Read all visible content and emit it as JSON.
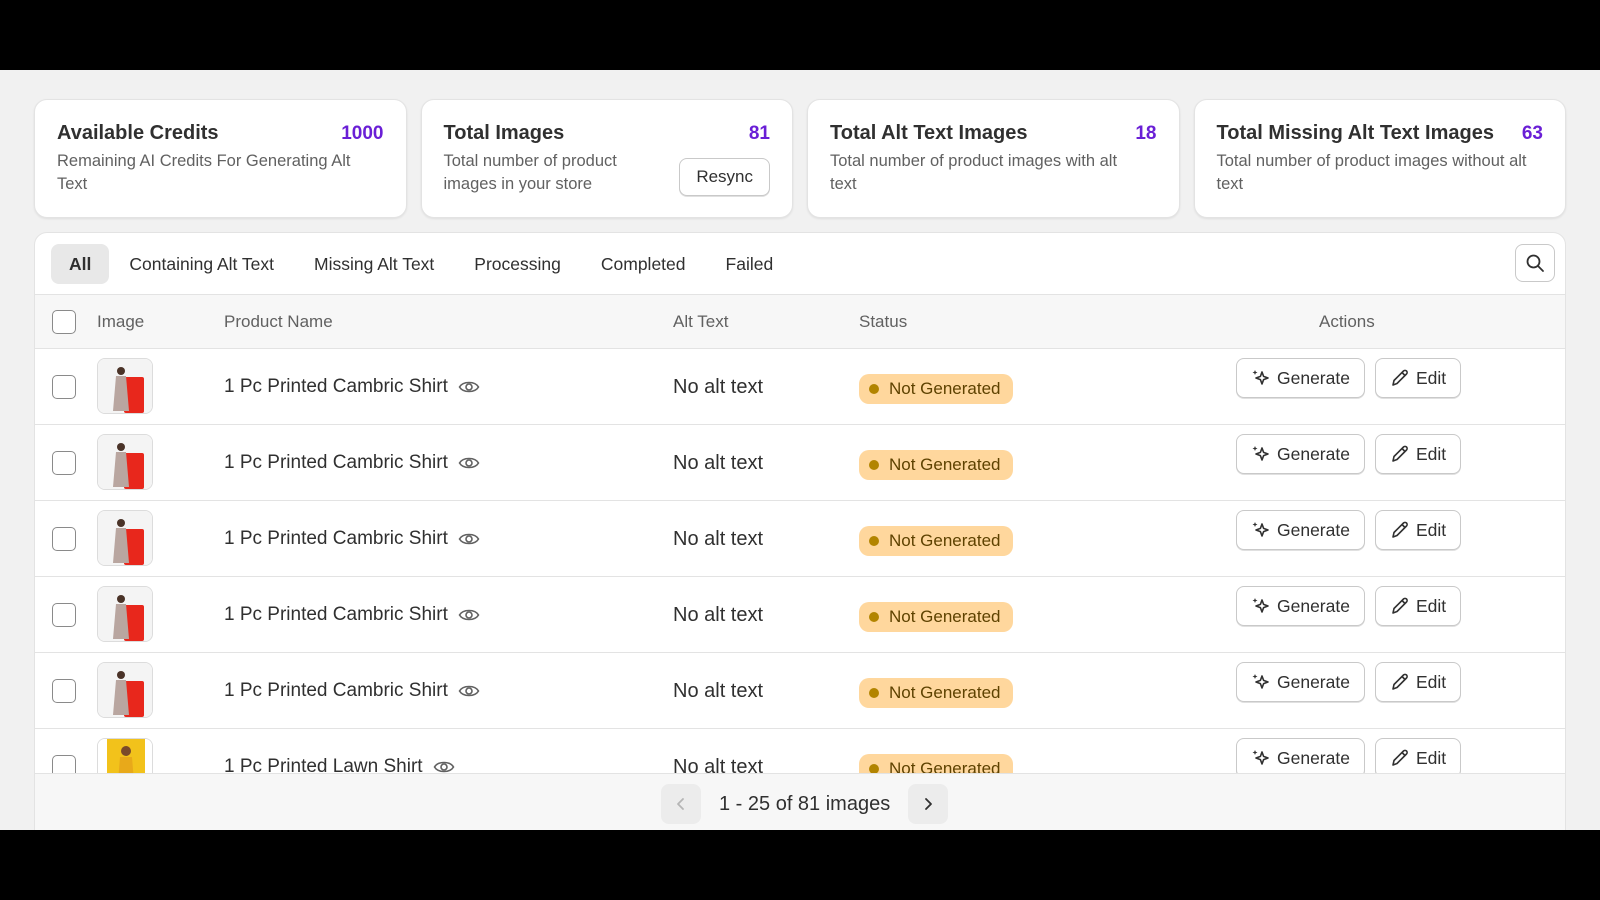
{
  "stats": [
    {
      "title": "Available Credits",
      "value": "1000",
      "desc": "Remaining AI Credits For Generating Alt Text"
    },
    {
      "title": "Total Images",
      "value": "81",
      "desc": "Total number of product images in your store",
      "button": "Resync"
    },
    {
      "title": "Total Alt Text Images",
      "value": "18",
      "desc": "Total number of product images with alt text"
    },
    {
      "title": "Total Missing Alt Text Images",
      "value": "63",
      "desc": "Total number of product images without alt text"
    }
  ],
  "tabs": [
    "All",
    "Containing Alt Text",
    "Missing Alt Text",
    "Processing",
    "Completed",
    "Failed"
  ],
  "columns": {
    "image": "Image",
    "product_name": "Product Name",
    "alt_text": "Alt Text",
    "status": "Status",
    "actions": "Actions"
  },
  "rows": [
    {
      "name": "1 Pc Printed Cambric Shirt",
      "alt": "No alt text",
      "status": "Not Generated",
      "generate": "Generate",
      "edit": "Edit",
      "thumb": "red"
    },
    {
      "name": "1 Pc Printed Cambric Shirt",
      "alt": "No alt text",
      "status": "Not Generated",
      "generate": "Generate",
      "edit": "Edit",
      "thumb": "red"
    },
    {
      "name": "1 Pc Printed Cambric Shirt",
      "alt": "No alt text",
      "status": "Not Generated",
      "generate": "Generate",
      "edit": "Edit",
      "thumb": "red"
    },
    {
      "name": "1 Pc Printed Cambric Shirt",
      "alt": "No alt text",
      "status": "Not Generated",
      "generate": "Generate",
      "edit": "Edit",
      "thumb": "red"
    },
    {
      "name": "1 Pc Printed Cambric Shirt",
      "alt": "No alt text",
      "status": "Not Generated",
      "generate": "Generate",
      "edit": "Edit",
      "thumb": "red"
    },
    {
      "name": "1 Pc Printed Lawn Shirt",
      "alt": "No alt text",
      "status": "Not Generated",
      "generate": "Generate",
      "edit": "Edit",
      "thumb": "yellow"
    }
  ],
  "pagination": {
    "label": "1 - 25 of 81 images"
  },
  "colors": {
    "accent": "#6a1fd6",
    "badge_bg": "#ffd79d",
    "badge_dot": "#b28400"
  },
  "icons": {
    "search": "search-icon",
    "eye": "eye-icon",
    "sparkle": "sparkle-icon",
    "pencil": "pencil-icon",
    "prev": "chevron-left-icon",
    "next": "chevron-right-icon"
  }
}
